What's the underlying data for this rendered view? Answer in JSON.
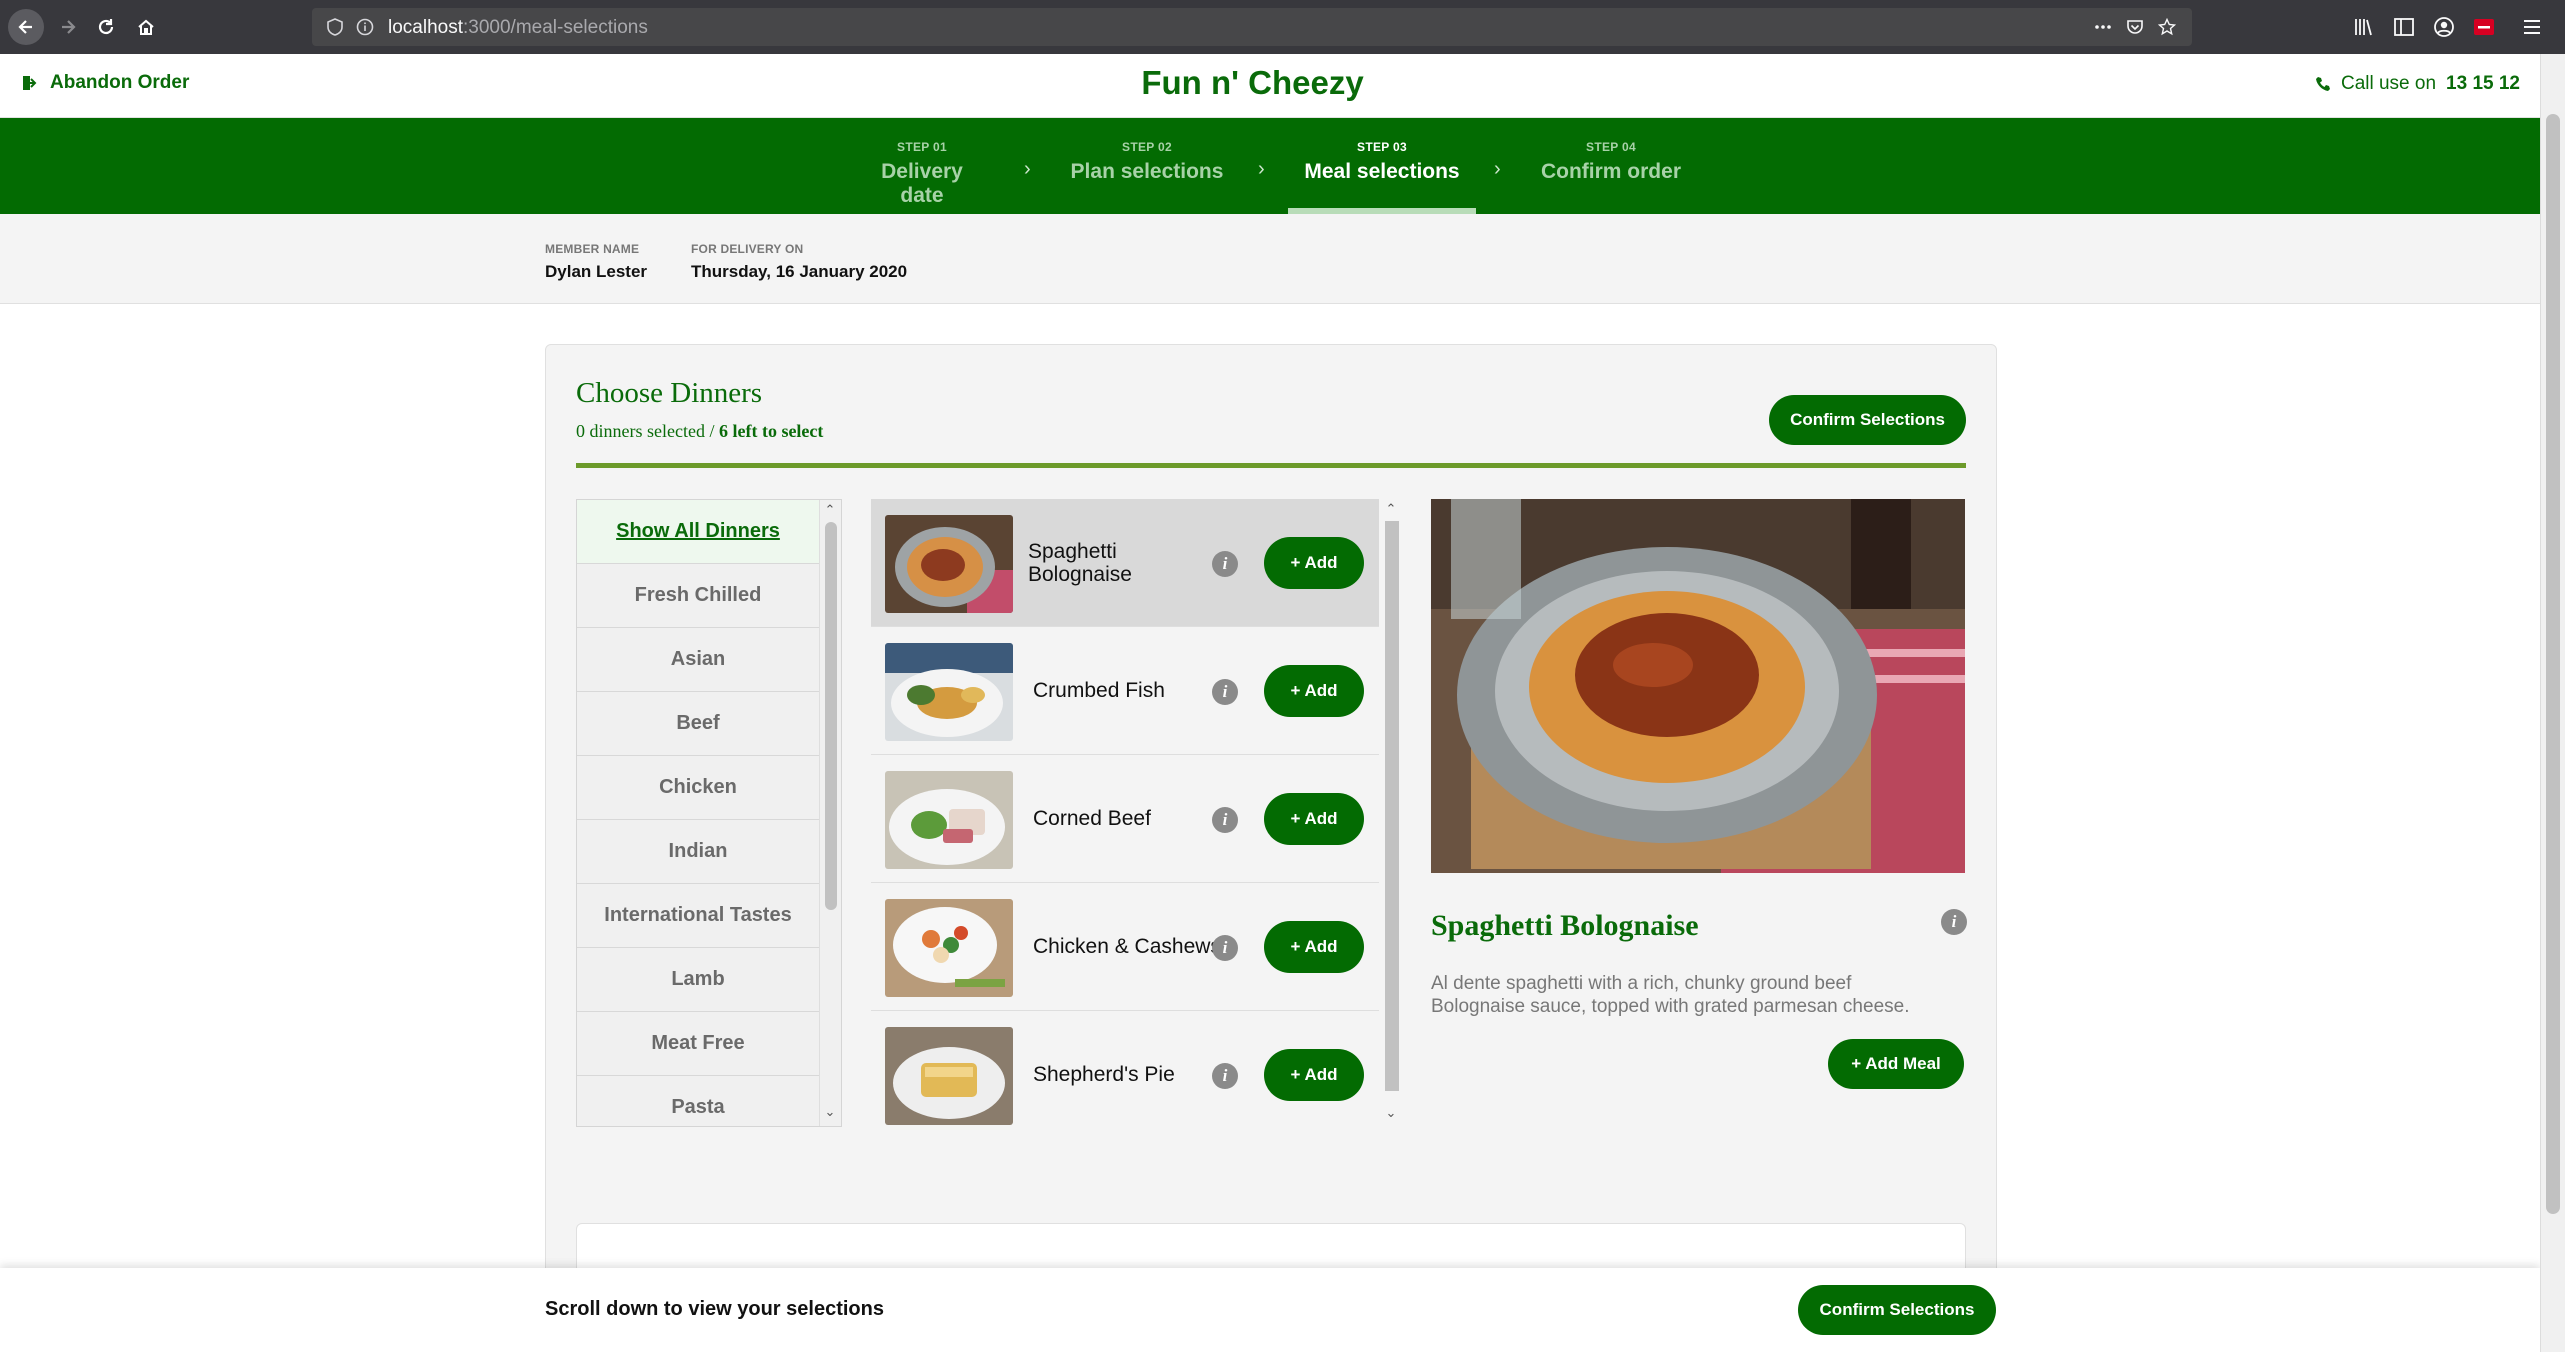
{
  "browser": {
    "url_host": "localhost",
    "url_path": ":3000/meal-selections"
  },
  "header": {
    "abandon_label": "Abandon Order",
    "brand": "Fun n' Cheezy",
    "call_prefix": "Call use on",
    "phone": "13 15 12"
  },
  "steps": [
    {
      "num": "STEP 01",
      "label": "Delivery date"
    },
    {
      "num": "STEP 02",
      "label": "Plan selections"
    },
    {
      "num": "STEP 03",
      "label": "Meal selections",
      "active": true
    },
    {
      "num": "STEP 04",
      "label": "Confirm order"
    }
  ],
  "member": {
    "name_key": "MEMBER NAME",
    "name": "Dylan Lester",
    "delivery_key": "FOR DELIVERY ON",
    "delivery": "Thursday, 16 January 2020"
  },
  "choose": {
    "title": "Choose Dinners",
    "selected_text": "0 dinners selected / ",
    "left_text": "6 left to select",
    "confirm_label": "Confirm Selections"
  },
  "categories": [
    "Show All Dinners",
    "Fresh Chilled",
    "Asian",
    "Beef",
    "Chicken",
    "Indian",
    "International Tastes",
    "Lamb",
    "Meat Free",
    "Pasta"
  ],
  "meals": [
    {
      "name": "Spaghetti Bolognaise",
      "add_label": "+ Add",
      "selected": true
    },
    {
      "name": "Crumbed Fish",
      "add_label": "+ Add"
    },
    {
      "name": "Corned Beef",
      "add_label": "+ Add"
    },
    {
      "name": "Chicken & Cashews",
      "add_label": "+ Add"
    },
    {
      "name": "Shepherd's Pie",
      "add_label": "+ Add"
    }
  ],
  "detail": {
    "title": "Spaghetti Bolognaise",
    "description": "Al dente spaghetti with a rich, chunky ground beef Bolognaise sauce, topped with grated parmesan cheese.",
    "add_label": "+ Add Meal"
  },
  "footer": {
    "text": "Scroll down to view your selections",
    "confirm_label": "Confirm Selections"
  },
  "colors": {
    "brand_green": "#036b02",
    "accent_rule": "#6c9a2a"
  }
}
